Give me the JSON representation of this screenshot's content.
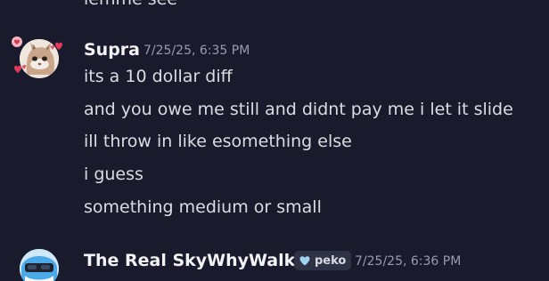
{
  "previous_message": {
    "text": "lemme see"
  },
  "messages": [
    {
      "username": "Supra",
      "timestamp": "7/25/25, 6:35 PM",
      "lines": [
        "its a 10 dollar diff",
        "and you owe me still and didnt pay me i let it slide",
        "ill throw in like esomething else",
        "i guess",
        "something medium or small"
      ]
    },
    {
      "username": "The Real SkyWhyWalker",
      "tag": {
        "label": "peko",
        "icon": "heart-icon"
      },
      "timestamp": "7/25/25, 6:36 PM"
    }
  ],
  "colors": {
    "background": "#191a2b",
    "username": "#f2f3f5",
    "message_text": "#dcdde2",
    "timestamp": "#9a9bab",
    "tag_bg": "#2f3145",
    "tag_heart": "#9fd3f0"
  }
}
